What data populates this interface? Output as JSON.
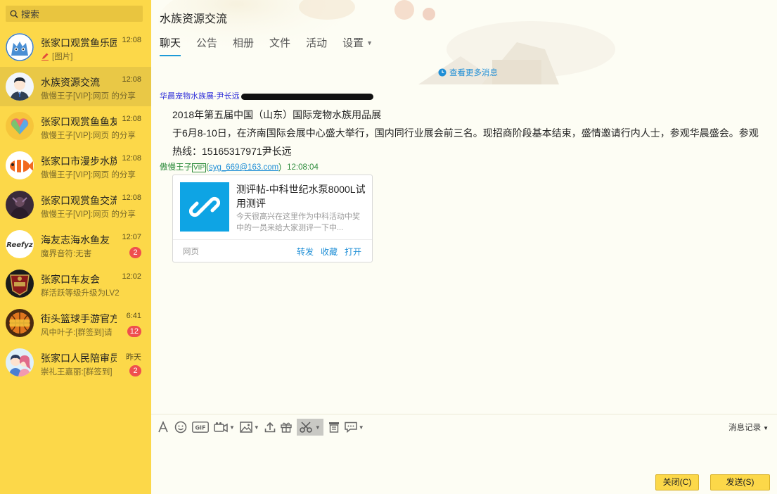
{
  "search": {
    "label": "搜索"
  },
  "conversations": [
    {
      "name": "张家口观赏鱼乐园",
      "time": "12:08",
      "sub": "[图片]",
      "badge": "",
      "avatar": "cat",
      "active": false
    },
    {
      "name": "水族资源交流",
      "time": "12:08",
      "sub": "傲慢王子[VIP]:网页 的分享",
      "badge": "",
      "avatar": "person",
      "active": true
    },
    {
      "name": "张家口观赏鱼鱼友",
      "time": "12:08",
      "sub": "傲慢王子[VIP]:网页 的分享",
      "badge": "",
      "avatar": "heart",
      "active": false
    },
    {
      "name": "张家口市漫步水族",
      "time": "12:08",
      "sub": "傲慢王子[VIP]:网页 的分享",
      "badge": "",
      "avatar": "clownfish",
      "active": false
    },
    {
      "name": "张家口观赏鱼交流",
      "time": "12:08",
      "sub": "傲慢王子[VIP]:网页 的分享",
      "badge": "",
      "avatar": "dark",
      "active": false
    },
    {
      "name": "海友志海水鱼友",
      "time": "12:07",
      "sub": "魔界音符:无害",
      "badge": "2",
      "avatar": "reefyz",
      "active": false
    },
    {
      "name": "张家口车友会",
      "time": "12:02",
      "sub": "群活跃等级升级为LV2",
      "badge": "",
      "avatar": "car",
      "active": false
    },
    {
      "name": "街头篮球手游官方",
      "time": "6:41",
      "sub": "风中叶子:[群签到]请",
      "badge": "12",
      "avatar": "ball",
      "active": false
    },
    {
      "name": "张家口人民陪审员",
      "time": "昨天",
      "sub": "崇礼王嘉丽:[群签到]",
      "badge": "2",
      "avatar": "couple",
      "active": false
    }
  ],
  "chat": {
    "title": "水族资源交流",
    "tabs": [
      "聊天",
      "公告",
      "相册",
      "文件",
      "活动",
      "设置"
    ],
    "more_messages": "查看更多消息",
    "msg1": {
      "sender": "华晨宠物水族展-尹长远",
      "lines": [
        "2018年第五届中国（山东）国际宠物水族用品展",
        "于6月8-10日，在济南国际会展中心盛大举行，国内同行业展会前三名。现招商阶段基本结束，盛情邀请行内人士，参观华晨盛会。参观热线：15165317971尹长远"
      ]
    },
    "msg2": {
      "sender": "傲慢王子",
      "vip": "VIP",
      "email": "syg_669@163.com",
      "time": "12:08:04",
      "card": {
        "title": "测评帖-中科世纪水泵8000L试用测评",
        "desc": "今天很高兴在这里作为中科活动中奖中的一员来给大家测评一下中...",
        "source": "网页",
        "share": "转发",
        "favorite": "收藏",
        "open": "打开"
      }
    }
  },
  "input": {
    "history": "消息记录",
    "close": "关闭(C)",
    "send": "发送(S)"
  },
  "colors": {
    "sidebar": "#fcd849",
    "active_row": "#e9c846",
    "accent": "#1e9bd8",
    "badge": "#ef4e4e"
  }
}
